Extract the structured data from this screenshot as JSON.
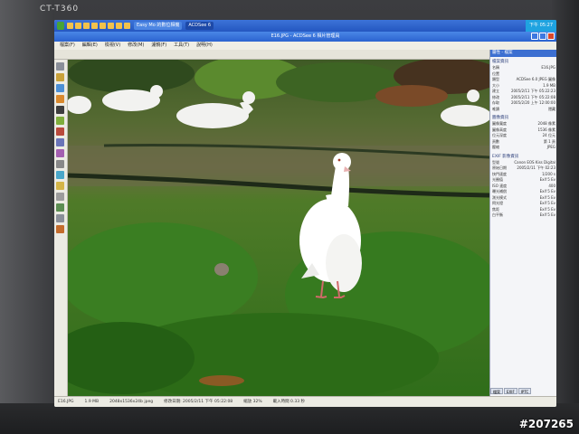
{
  "monitor": {
    "model": "CT-T360",
    "watermark": "#207265"
  },
  "taskbar": {
    "tasks": [
      {
        "label": "Easy Mo 的數位相機"
      },
      {
        "label": "ACDSee 6"
      }
    ],
    "clock": "下午 05:27"
  },
  "window": {
    "title": "E16.JPG - ACDSee 6 相片管理員"
  },
  "menu": {
    "items": [
      {
        "label": "檔案(F)"
      },
      {
        "label": "編輯(E)"
      },
      {
        "label": "檢視(V)"
      },
      {
        "label": "修改(M)"
      },
      {
        "label": "濾鏡(F)"
      },
      {
        "label": "工具(T)"
      },
      {
        "label": "說明(H)"
      }
    ]
  },
  "properties": {
    "header": "屬性 - 檔案",
    "file_section": "檔案資訊",
    "file_lines": [
      {
        "k": "名稱",
        "v": "E16.JPG"
      },
      {
        "k": "位置",
        "v": ""
      },
      {
        "k": "類型",
        "v": "ACDSee 6.0 JPEG 圖像"
      },
      {
        "k": "大小",
        "v": "1.9 MB"
      },
      {
        "k": "建立",
        "v": "2005/2/11 下午 05:22:23"
      },
      {
        "k": "修改",
        "v": "2005/2/11 下午 05:22:08"
      },
      {
        "k": "存取",
        "v": "2005/2/20 上午 12:00:00"
      },
      {
        "k": "唯讀",
        "v": "隱藏"
      }
    ],
    "image_section": "圖像資訊",
    "image_lines": [
      {
        "k": "圖像寬度",
        "v": "2048 像素"
      },
      {
        "k": "圖像高度",
        "v": "1536 像素"
      },
      {
        "k": "位元深度",
        "v": "24 位元"
      },
      {
        "k": "頁數",
        "v": "第 1 頁"
      },
      {
        "k": "壓縮",
        "v": "JPEG"
      }
    ],
    "exif_section": "EXIF 影像資訊",
    "exif_lines": [
      {
        "k": "型號",
        "v": "Canon EOS Kiss Digital"
      },
      {
        "k": "原始日期",
        "v": "2005/2/11 下午 02:23"
      },
      {
        "k": "快門速度",
        "v": "1/200 s"
      },
      {
        "k": "光圈值",
        "v": "Exif 5 Ev"
      },
      {
        "k": "ISO 速度",
        "v": "400"
      },
      {
        "k": "曝光補償",
        "v": "Exif 5 Ev"
      },
      {
        "k": "測光模式",
        "v": "Exif 5 Ev"
      },
      {
        "k": "閃光燈",
        "v": "Exif 5 Ev"
      },
      {
        "k": "焦距",
        "v": "Exif 5 Ev"
      },
      {
        "k": "白平衡",
        "v": "Exif 5 Ev"
      }
    ],
    "tabs": [
      {
        "label": "檔案"
      },
      {
        "label": "EXIF"
      },
      {
        "label": "IPTC"
      }
    ]
  },
  "statusbar": {
    "items": [
      "E16.JPG",
      "1.9 MB",
      "2048x1536x24b jpeg",
      "修改日期: 2005/2/11 下午 05:22:08",
      "縮放 32%",
      "載入時間 0.33 秒"
    ]
  },
  "colors": {
    "taskbar": "#2457c0",
    "titlebar": "#2b63d0",
    "grass": "#2f6a1c",
    "dove": "#ffffff"
  }
}
